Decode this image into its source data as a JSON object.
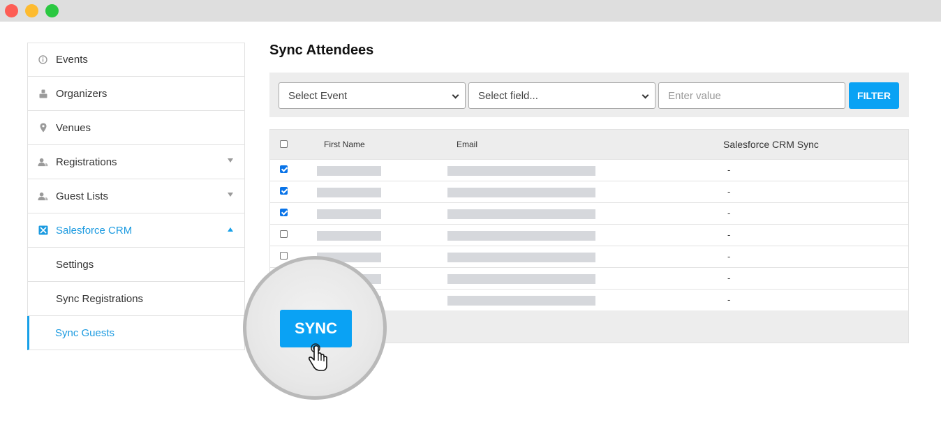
{
  "sidebar": {
    "items": [
      {
        "label": "Events",
        "icon": "info-icon"
      },
      {
        "label": "Organizers",
        "icon": "user-icon"
      },
      {
        "label": "Venues",
        "icon": "map-pin-icon"
      },
      {
        "label": "Registrations",
        "icon": "users-icon"
      },
      {
        "label": "Guest Lists",
        "icon": "users-icon"
      },
      {
        "label": "Salesforce CRM",
        "icon": "salesforce-icon"
      },
      {
        "label": "Settings"
      },
      {
        "label": "Sync Registrations"
      },
      {
        "label": "Sync Guests"
      }
    ]
  },
  "main": {
    "title": "Sync Attendees",
    "filters": {
      "event_select": "Select Event",
      "field_select": "Select field...",
      "value_placeholder": "Enter value",
      "filter_button": "FILTER"
    },
    "table": {
      "headers": {
        "first_name": "First Name",
        "email": "Email",
        "crm_sync": "Salesforce CRM Sync"
      },
      "rows": [
        {
          "checked": true,
          "crm_sync": "-"
        },
        {
          "checked": true,
          "crm_sync": "-"
        },
        {
          "checked": true,
          "crm_sync": "-"
        },
        {
          "checked": false,
          "crm_sync": "-"
        },
        {
          "checked": false,
          "crm_sync": "-"
        },
        {
          "checked": false,
          "crm_sync": "-"
        },
        {
          "checked": false,
          "crm_sync": "-"
        }
      ]
    },
    "sync_button": "SYNC"
  },
  "colors": {
    "accent": "#0aa2f4",
    "active_text": "#1b9ae0",
    "placeholder_bar": "#d6d8dc"
  }
}
